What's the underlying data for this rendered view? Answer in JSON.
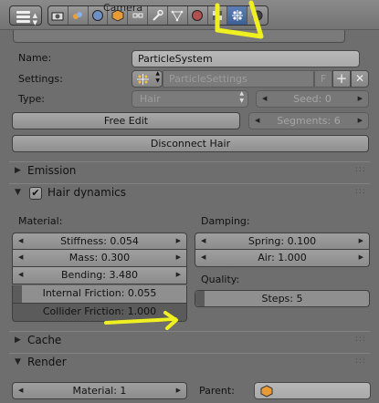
{
  "header": {
    "crumb": "Camera",
    "context_icons": [
      "render-icon",
      "scene-icon",
      "world-icon",
      "object-icon",
      "constraints-icon",
      "modifier-icon",
      "data-icon",
      "material-icon",
      "texture-icon",
      "particles-icon",
      "physics-icon"
    ],
    "active_icon": "particles-icon"
  },
  "particle": {
    "name_label": "Name:",
    "name_value": "ParticleSystem",
    "settings_label": "Settings:",
    "settings_value": "ParticleSettings",
    "settings_flag": "F",
    "type_label": "Type:",
    "type_value": "Hair",
    "seed": "Seed: 0",
    "free_edit": "Free Edit",
    "segments": "Segments: 6",
    "disconnect": "Disconnect Hair"
  },
  "sections": {
    "emission": "Emission",
    "hair_dynamics": "Hair dynamics",
    "cache": "Cache",
    "render": "Render"
  },
  "dynamics": {
    "material_label": "Material:",
    "stiffness": "Stiffness: 0.054",
    "mass": "Mass: 0.300",
    "bending": "Bending: 3.480",
    "internal_friction": "Internal Friction: 0.055",
    "internal_friction_level": 0.055,
    "collider_friction": "Collider Friction: 1.000",
    "collider_friction_level": 1.0,
    "damping_label": "Damping:",
    "spring": "Spring: 0.100",
    "air": "Air: 1.000",
    "quality_label": "Quality:",
    "steps": "Steps: 5"
  },
  "render": {
    "material": "Material: 1",
    "parent_label": "Parent:"
  },
  "colors": {
    "annotation": "#f0f020",
    "active_tab": "#4a6ea8"
  }
}
